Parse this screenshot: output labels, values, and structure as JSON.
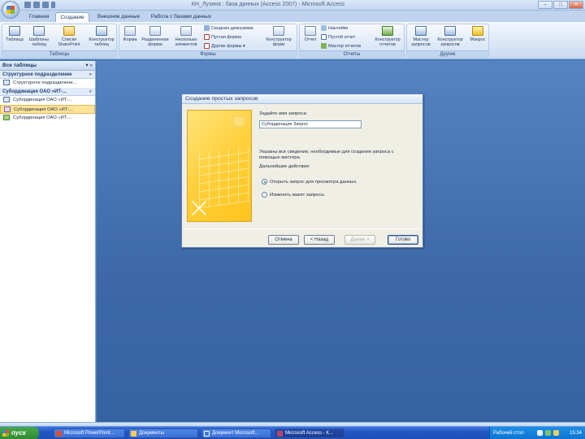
{
  "window": {
    "title": "КН_Лузина : база данных (Access 2007) - Microsoft Access"
  },
  "window_controls": {
    "minimize": "–",
    "maximize": "□",
    "close": "✕"
  },
  "ribbon_tabs": [
    "Главная",
    "Создание",
    "Внешние данные",
    "Работа с базами данных"
  ],
  "ribbon": {
    "tables_group": "Таблицы",
    "forms_group": "Формы",
    "reports_group": "Отчеты",
    "other_group": "Другие",
    "table": "Таблица",
    "table_templates": "Шаблоны таблиц",
    "sharepoint_lists": "Списки SharePoint",
    "table_designer": "Конструктор таблиц",
    "form": "Форма",
    "split_form": "Разделенная форма",
    "multiple_items": "Несколько элементов",
    "pivot_chart": "Сводная диаграмма",
    "blank_form": "Пустая форма",
    "other_forms": "Другие формы",
    "form_designer": "Конструктор форм",
    "report": "Отчет",
    "labels": "Наклейки",
    "blank_report": "Пустой отчет",
    "report_wizard": "Мастер отчетов",
    "report_designer": "Конструктор отчетов",
    "query_wizard": "Мастер запросов",
    "query_designer": "Конструктор запросов",
    "macro": "Макрос"
  },
  "nav": {
    "header": "Все таблицы",
    "group1": "Структурное подразделение",
    "group1_item": "Структурное подразделени...",
    "group2": "Субординация ОАО «ИТ-...",
    "items": [
      "Субординация ОАО «ИТ-...",
      "Субординация ОАО «ИТ-...",
      "Субординация ОАО «ИТ-..."
    ]
  },
  "dialog": {
    "title": "Создание простых запросов",
    "question": "Задайте имя запроса:",
    "name_value": "Субординация Запрос",
    "hint": "Указаны все сведения, необходимые для создания запроса с помощью мастера.",
    "next_action": "Дальнейшие действия:",
    "option_open": "Открыть запрос для просмотра данных.",
    "option_modify": "Изменить макет запроса.",
    "cancel": "Отмена",
    "back": "< Назад",
    "next": "Далее >",
    "finish": "Готово"
  },
  "taskbar": {
    "start": "пуск",
    "tasks": [
      "Microsoft PowerPoint...",
      "Документы",
      "Документ Microsoft...",
      "Microsoft Access - К..."
    ],
    "tray_label": "Рабочий стол",
    "clock": "15:34"
  },
  "colors": {
    "workspace": "#3f6aa9",
    "dialog_art": "#ffcf3a",
    "selected_item": "#ffe39a",
    "taskbar": "#2457c4",
    "start": "#2c8a2f"
  }
}
